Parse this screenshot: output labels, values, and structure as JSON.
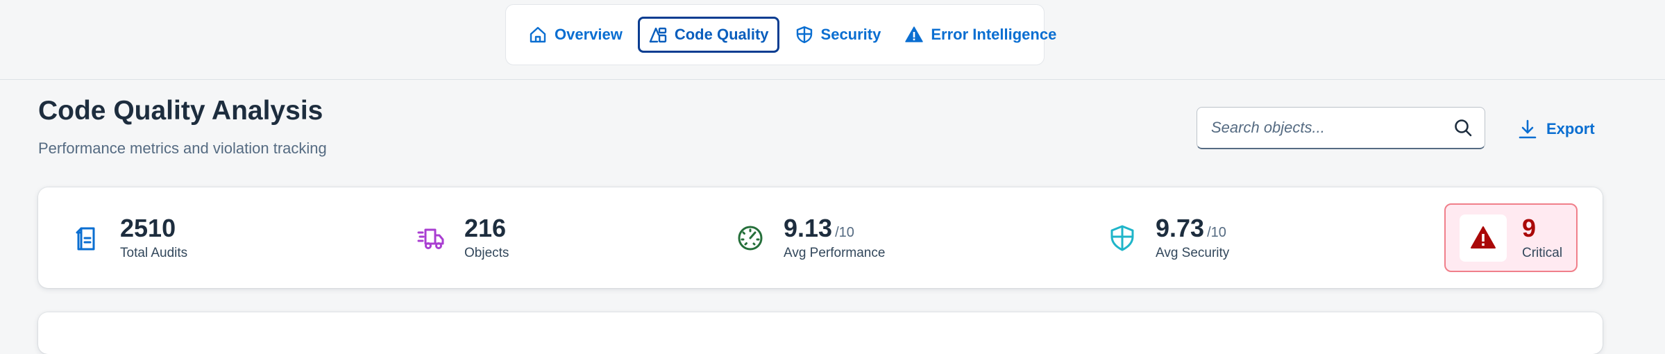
{
  "nav": {
    "tabs": [
      {
        "label": "Overview",
        "icon": "home-icon",
        "active": false
      },
      {
        "label": "Code Quality",
        "icon": "code-quality-icon",
        "active": true
      },
      {
        "label": "Security",
        "icon": "shield-icon",
        "active": false
      },
      {
        "label": "Error Intelligence",
        "icon": "warning-icon",
        "active": false
      }
    ]
  },
  "header": {
    "title": "Code Quality Analysis",
    "subtitle": "Performance metrics and violation tracking"
  },
  "search": {
    "placeholder": "Search objects...",
    "value": ""
  },
  "toolbar": {
    "export_label": "Export"
  },
  "kpis": {
    "total_audits": {
      "value": "2510",
      "label": "Total Audits",
      "icon": "document-icon",
      "color": "#0a6ed1"
    },
    "objects": {
      "value": "216",
      "label": "Objects",
      "icon": "delivery-truck-icon",
      "color": "#a93ed1"
    },
    "avg_performance": {
      "value": "9.13",
      "suffix": "/10",
      "label": "Avg Performance",
      "icon": "speedometer-icon",
      "color": "#256f3a"
    },
    "avg_security": {
      "value": "9.73",
      "suffix": "/10",
      "label": "Avg Security",
      "icon": "shield-icon",
      "color": "#1fb5c9"
    },
    "critical": {
      "value": "9",
      "label": "Critical",
      "icon": "warning-icon",
      "color": "#aa0808"
    }
  },
  "colors": {
    "accent": "#0a6ed1",
    "active_tab_border": "#0a3d91",
    "critical_bg": "#ffeaf1",
    "critical_border": "#f07f8a",
    "critical_text": "#aa0808",
    "page_bg": "#f5f6f7"
  }
}
